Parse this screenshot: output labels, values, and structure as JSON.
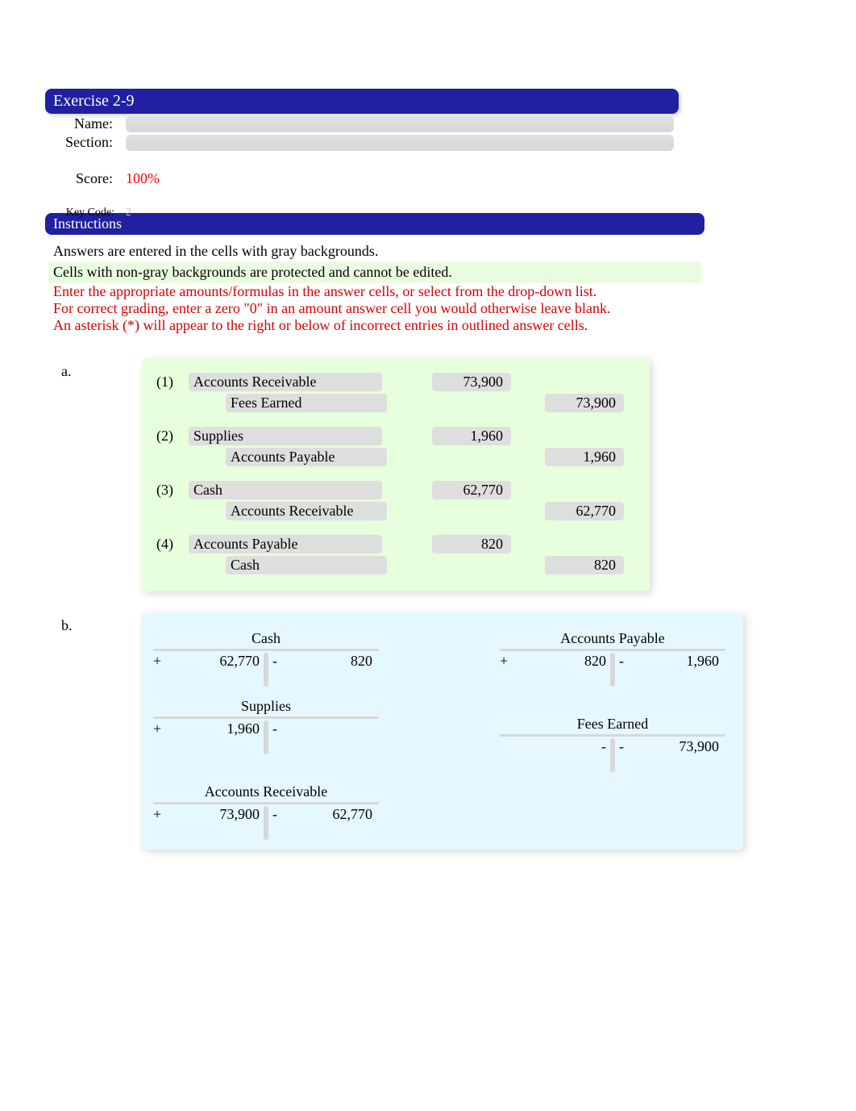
{
  "header": {
    "title": "Exercise 2-9",
    "name_label": "Name:",
    "section_label": "Section:",
    "score_label": "Score:",
    "score_value": "100%",
    "keycode_label": "Key Code:",
    "keycode_value": "2",
    "instructions_title": "Instructions"
  },
  "instructions": {
    "line1": "Answers are entered in the cells with gray backgrounds.",
    "line2": "Cells with non-gray backgrounds are protected and cannot be edited.",
    "line3": "Enter the appropriate amounts/formulas in the answer cells, or select from the drop-down list.",
    "line4": "For correct grading, enter a zero \"0\" in an amount answer cell you would otherwise leave blank.",
    "line5": "An asterisk (*) will appear to the right or below of incorrect entries in outlined answer cells."
  },
  "parts": {
    "a_label": "a.",
    "b_label": "b."
  },
  "journal": [
    {
      "num": "(1)",
      "debit_account": "Accounts Receivable",
      "debit_amount": "73,900",
      "credit_account": "Fees Earned",
      "credit_amount": "73,900"
    },
    {
      "num": "(2)",
      "debit_account": "Supplies",
      "debit_amount": "1,960",
      "credit_account": "Accounts Payable",
      "credit_amount": "1,960"
    },
    {
      "num": "(3)",
      "debit_account": "Cash",
      "debit_amount": "62,770",
      "credit_account": "Accounts Receivable",
      "credit_amount": "62,770"
    },
    {
      "num": "(4)",
      "debit_account": "Accounts Payable",
      "debit_amount": "820",
      "credit_account": "Cash",
      "credit_amount": "820"
    }
  ],
  "taccounts": {
    "cash": {
      "title": "Cash",
      "left_sign": "+",
      "left_val": "62,770",
      "right_sign": "-",
      "right_val": "820"
    },
    "ap": {
      "title": "Accounts Payable",
      "left_sign": "+",
      "left_val": "820",
      "right_sign": "-",
      "right_val": "1,960"
    },
    "supplies": {
      "title": "Supplies",
      "left_sign": "+",
      "left_val": "1,960",
      "right_sign": "-",
      "right_val": ""
    },
    "fees": {
      "title": "Fees Earned",
      "left_sign": "",
      "left_val": "-",
      "right_sign": "-",
      "right_val": "73,900"
    },
    "ar": {
      "title": "Accounts Receivable",
      "left_sign": "+",
      "left_val": "73,900",
      "right_sign": "-",
      "right_val": "62,770"
    }
  }
}
